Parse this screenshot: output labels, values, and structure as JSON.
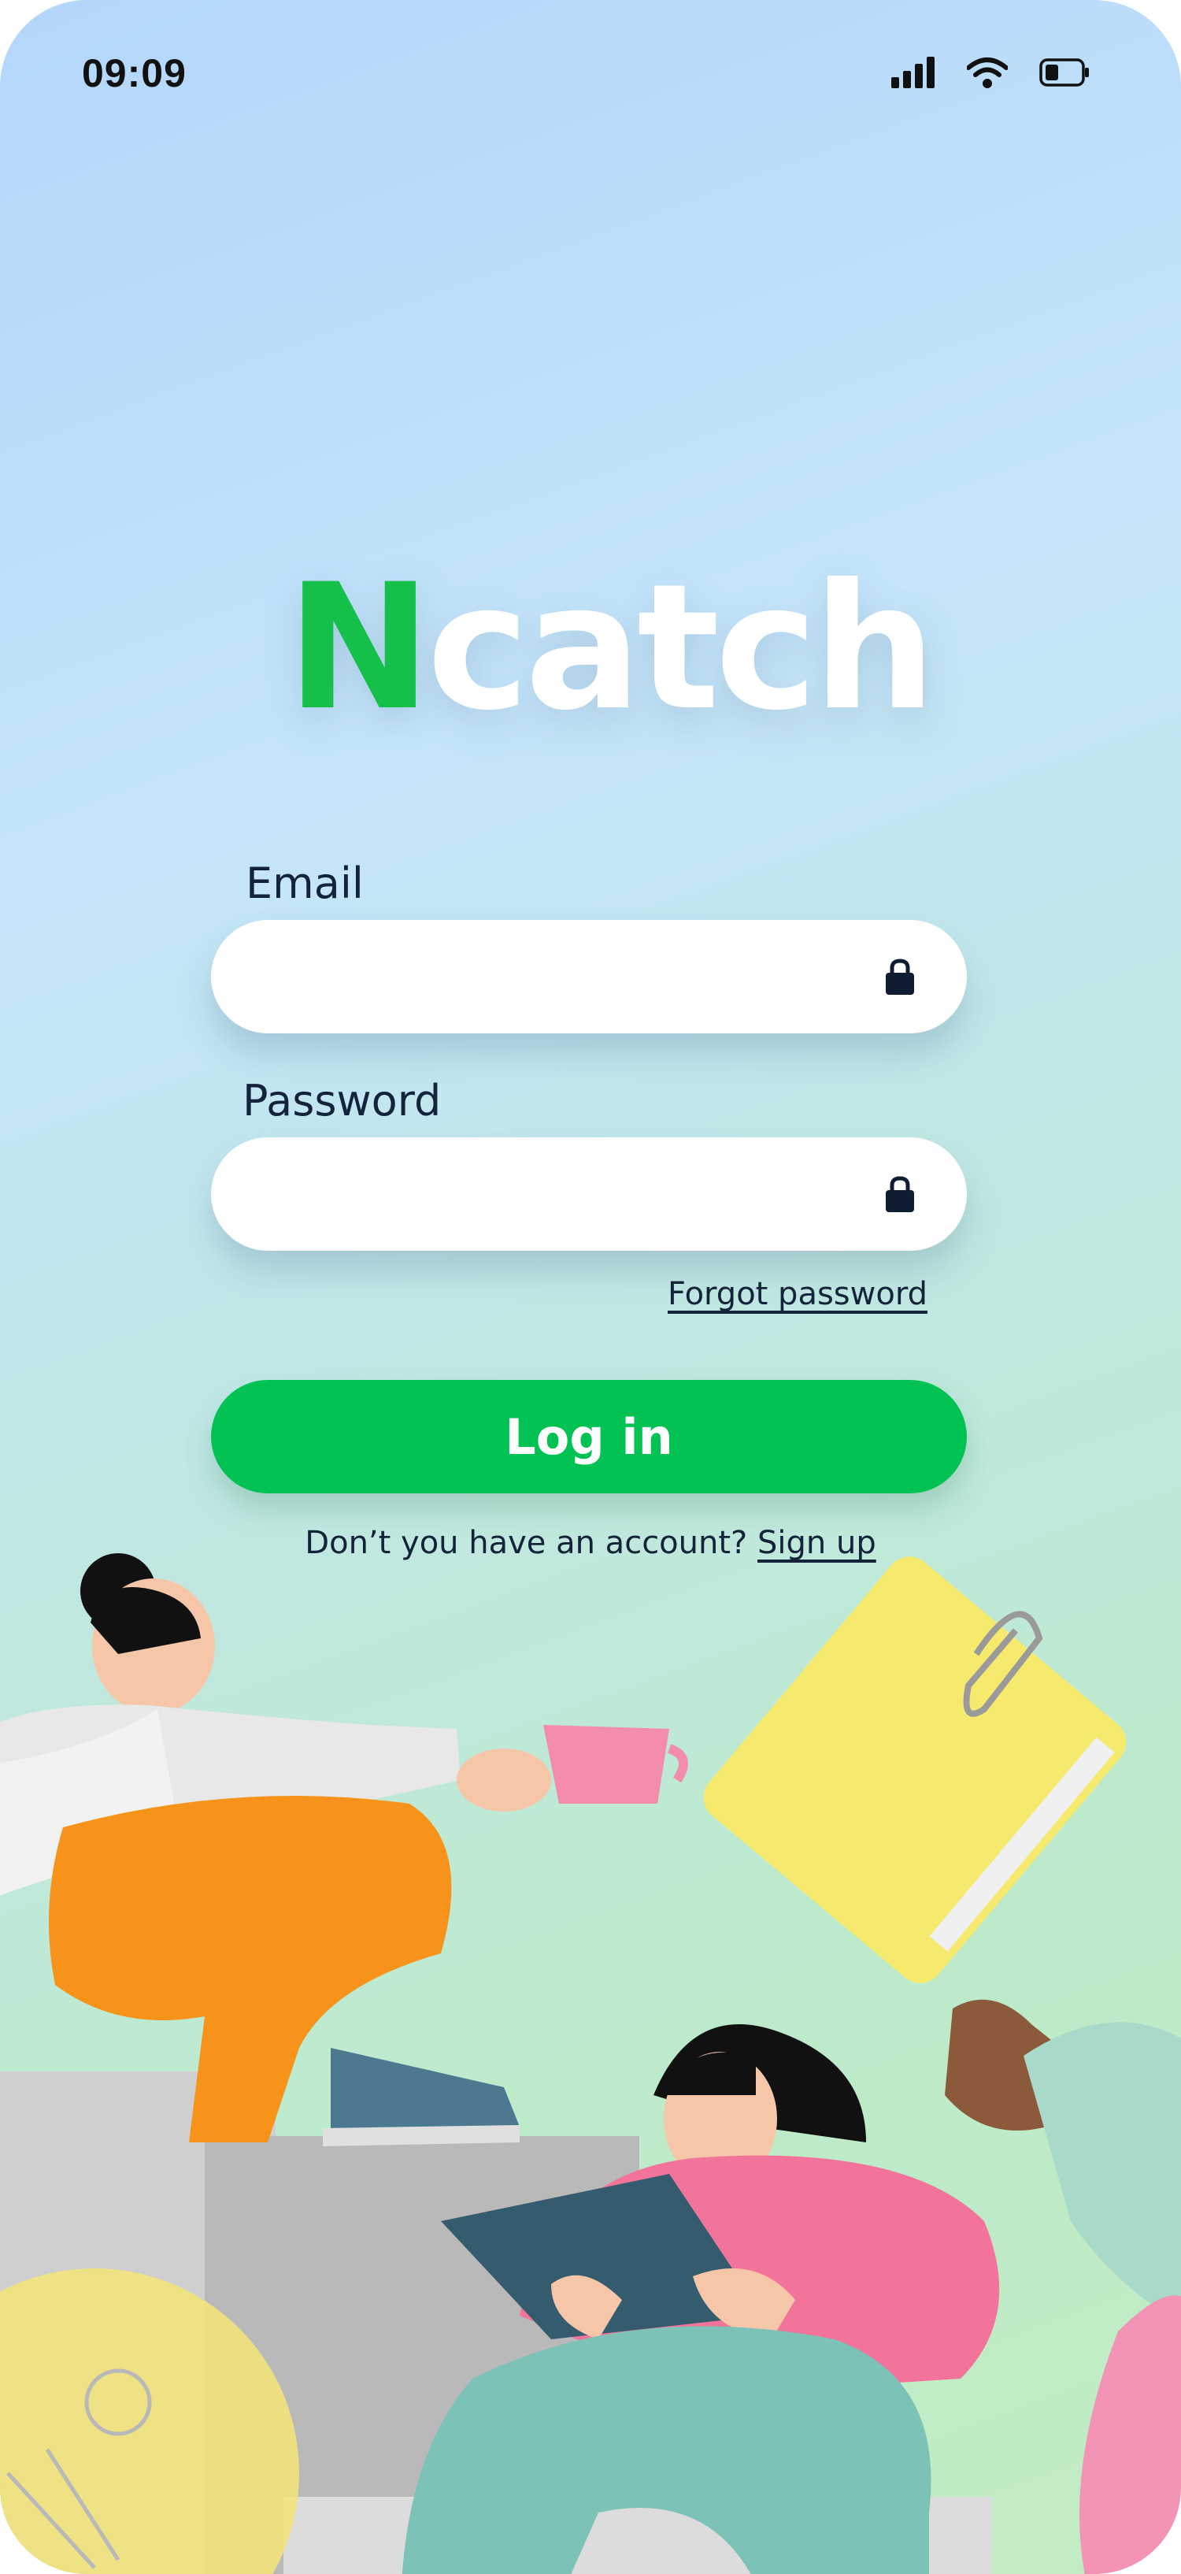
{
  "status_bar": {
    "time": "09:09"
  },
  "logo": {
    "part1": "N",
    "part2": "catch"
  },
  "form": {
    "email_label": "Email",
    "email_value": "",
    "password_label": "Password",
    "password_value": "",
    "forgot_label": "Forgot password",
    "login_label": "Log in",
    "signup_prompt": "Don’t you have an account?",
    "signup_link": "Sign up"
  },
  "colors": {
    "brand_green": "#03c254",
    "text_dark": "#12233a"
  },
  "icons": [
    "signal-icon",
    "wifi-icon",
    "battery-icon",
    "lock-icon"
  ]
}
